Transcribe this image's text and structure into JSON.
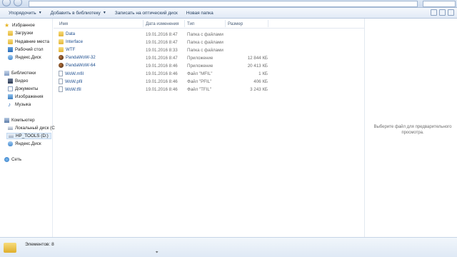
{
  "toolbar": {
    "organize": "Упорядочить",
    "add_to_library": "Добавить в библиотеку",
    "burn": "Записать на оптический диск",
    "new_folder": "Новая папка"
  },
  "nav": {
    "favorites": "Избранное",
    "downloads": "Загрузки",
    "recent": "Недавние места",
    "desktop": "Рабочий стол",
    "yadisk1": "Яндекс.Диск",
    "libraries": "Библиотеки",
    "video": "Видео",
    "documents": "Документы",
    "images": "Изображения",
    "music": "Музыка",
    "computer": "Компьютер",
    "local_disk": "Локальный диск (C",
    "hp_tools": "HP_TOOLS (D:)",
    "yadisk2": "Яндекс.Диск",
    "network": "Сеть"
  },
  "columns": {
    "name": "Имя",
    "date": "Дата изменения",
    "type": "Тип",
    "size": "Размер"
  },
  "files": [
    {
      "name": "Data",
      "date": "19.01.2016 8:47",
      "type": "Папка с файлами",
      "size": "",
      "icon": "folder-icon"
    },
    {
      "name": "Interface",
      "date": "19.01.2016 8:47",
      "type": "Папка с файлами",
      "size": "",
      "icon": "folder-icon"
    },
    {
      "name": "WTF",
      "date": "19.01.2016 8:33",
      "type": "Папка с файлами",
      "size": "",
      "icon": "folder-icon"
    },
    {
      "name": "PandaWoW-32",
      "date": "19.01.2016 8:47",
      "type": "Приложение",
      "size": "12 844 КБ",
      "icon": "app-icon"
    },
    {
      "name": "PandaWoW-64",
      "date": "19.01.2016 8:46",
      "type": "Приложение",
      "size": "20 413 КБ",
      "icon": "app-icon"
    },
    {
      "name": "WoW.mfil",
      "date": "19.01.2016 8:46",
      "type": "Файл \"MFIL\"",
      "size": "1 КБ",
      "icon": "file-icon"
    },
    {
      "name": "WoW.pfil",
      "date": "19.01.2016 8:46",
      "type": "Файл \"PFIL\"",
      "size": "406 КБ",
      "icon": "file-icon"
    },
    {
      "name": "WoW.tfil",
      "date": "19.01.2016 8:46",
      "type": "Файл \"TFIL\"",
      "size": "3 243 КБ",
      "icon": "file-icon"
    }
  ],
  "preview": {
    "message": "Выберите файл для предварительного просмотра."
  },
  "status": {
    "count": "Элементов: 8"
  }
}
